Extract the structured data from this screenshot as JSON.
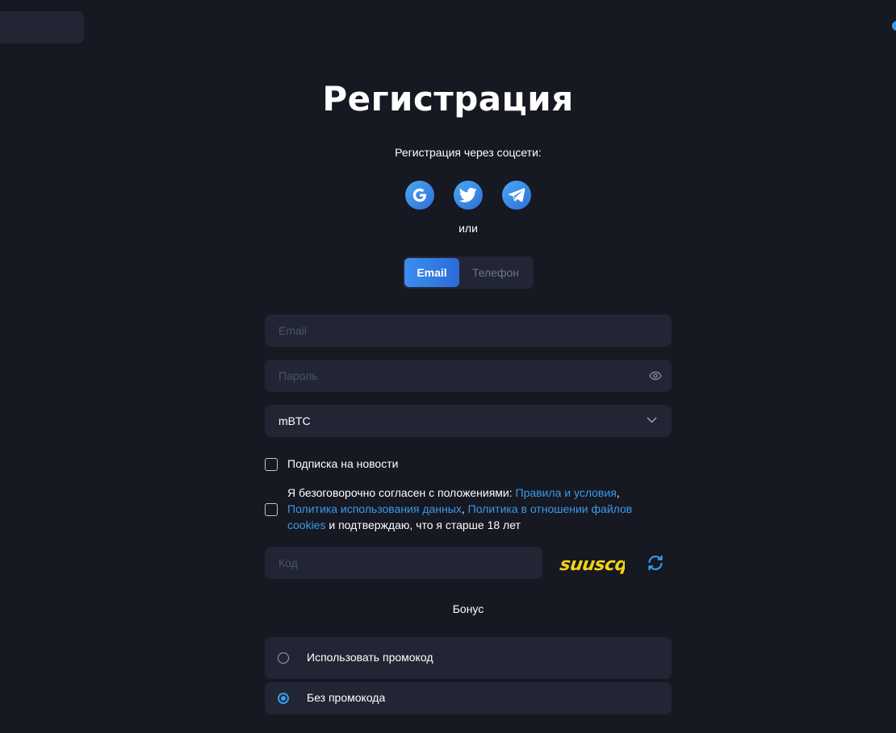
{
  "page": {
    "title": "Регистрация",
    "social_prompt": "Регистрация через соцсети:",
    "social_icons": [
      "google-icon",
      "twitter-icon",
      "telegram-icon"
    ],
    "or_text": "или"
  },
  "tabs": {
    "email_label": "Email",
    "phone_label": "Телефон",
    "active": "email"
  },
  "form": {
    "email_placeholder": "Email",
    "email_value": "",
    "password_placeholder": "Пароль",
    "password_value": "",
    "currency_value": "mBTC",
    "newsletter_label": "Подписка на новости",
    "newsletter_checked": false,
    "terms_checked": false,
    "terms": {
      "prefix": "Я безоговорочно согласен с положениями: ",
      "rules_link": "Правила и условия",
      "sep1": ", ",
      "privacy_link": "Политика использования данных",
      "sep2": ", ",
      "cookies_link": "Политика в отношении файлов cookies",
      "suffix": " и подтверждаю, что я старше 18 лет"
    },
    "code_placeholder": "Код",
    "code_value": "",
    "captcha_text": "suuscq"
  },
  "bonus": {
    "title": "Бонус",
    "options": [
      "Использовать промокод",
      "Без промокода"
    ],
    "selected_index": 1
  },
  "colors": {
    "background": "#161822",
    "panel": "#222634",
    "accent": "#3a9ae8",
    "captcha_yellow": "#f4d21a"
  }
}
